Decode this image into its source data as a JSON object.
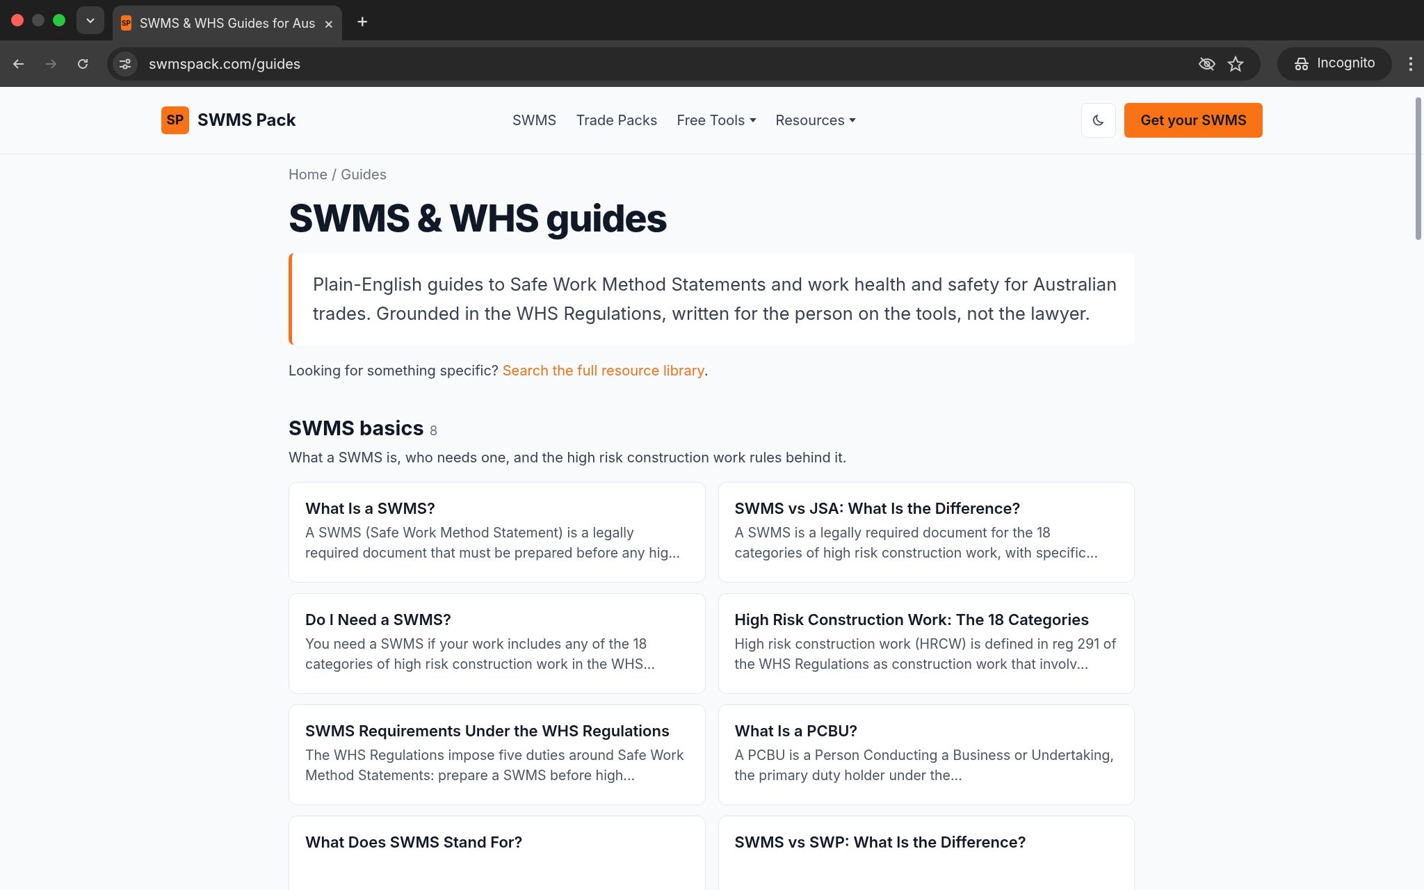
{
  "browser": {
    "tab": {
      "favicon": "SP",
      "title": "SWMS & WHS Guides for Aus",
      "close": "×"
    },
    "new_tab": "+",
    "url": "swmspack.com/guides",
    "profile": "Incognito"
  },
  "header": {
    "logo_mark": "SP",
    "logo_text": "SWMS Pack",
    "nav": [
      {
        "label": "SWMS",
        "dropdown": false
      },
      {
        "label": "Trade Packs",
        "dropdown": false
      },
      {
        "label": "Free Tools",
        "dropdown": true
      },
      {
        "label": "Resources",
        "dropdown": true
      }
    ],
    "cta": "Get your SWMS"
  },
  "breadcrumb": [
    "Home",
    "/",
    "Guides"
  ],
  "title": "SWMS & WHS guides",
  "intro": "Plain-English guides to Safe Work Method Statements and work health and safety for Australian trades. Grounded in the WHS Regulations, written for the person on the tools, not the lawyer.",
  "search_note": {
    "text": "Looking for something specific?",
    "link": "Search the full resource library",
    "end": "."
  },
  "sections": [
    {
      "title": "SWMS basics",
      "count": "8",
      "description": "What a SWMS is, who needs one, and the high risk construction work rules behind it.",
      "cards": [
        {
          "title": "What Is a SWMS?",
          "excerpt": "A SWMS (Safe Work Method Statement) is a legally required document that must be prepared before any hig..."
        },
        {
          "title": "SWMS vs JSA: What Is the Difference?",
          "excerpt": "A SWMS is a legally required document for the 18 categories of high risk construction work, with specific..."
        },
        {
          "title": "Do I Need a SWMS?",
          "excerpt": "You need a SWMS if your work includes any of the 18 categories of high risk construction work in the WHS..."
        },
        {
          "title": "High Risk Construction Work: The 18 Categories",
          "excerpt": "High risk construction work (HRCW) is defined in reg 291 of the WHS Regulations as construction work that involv..."
        },
        {
          "title": "SWMS Requirements Under the WHS Regulations",
          "excerpt": "The WHS Regulations impose five duties around Safe Work Method Statements: prepare a SWMS before high..."
        },
        {
          "title": "What Is a PCBU?",
          "excerpt": "A PCBU is a Person Conducting a Business or Undertaking, the primary duty holder under the..."
        },
        {
          "title": "What Does SWMS Stand For?"
        },
        {
          "title": "SWMS vs SWP: What Is the Difference?"
        }
      ]
    }
  ]
}
